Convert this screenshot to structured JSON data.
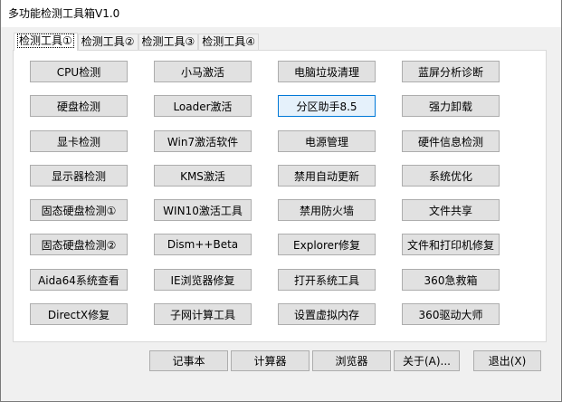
{
  "window": {
    "title": "多功能检测工具箱V1.0"
  },
  "tabs": [
    {
      "label": "检测工具①",
      "active": true
    },
    {
      "label": "检测工具②",
      "active": false
    },
    {
      "label": "检测工具③",
      "active": false
    },
    {
      "label": "检测工具④",
      "active": false
    }
  ],
  "grid": {
    "columns": [
      [
        "CPU检测",
        "硬盘检测",
        "显卡检测",
        "显示器检测",
        "固态硬盘检测①",
        "固态硬盘检测②",
        "Aida64系统查看",
        "DirectX修复"
      ],
      [
        "小马激活",
        "Loader激活",
        "Win7激活软件",
        "KMS激活",
        "WIN10激活工具",
        "Dism++Beta",
        "IE浏览器修复",
        "子网计算工具"
      ],
      [
        "电脑垃圾清理",
        "分区助手8.5",
        "电源管理",
        "禁用自动更新",
        "禁用防火墙",
        "Explorer修复",
        "打开系统工具",
        "设置虚拟内存"
      ],
      [
        "蓝屏分析诊断",
        "强力卸载",
        "硬件信息检测",
        "系统优化",
        "文件共享",
        "文件和打印机修复",
        "360急救箱",
        "360驱动大师"
      ]
    ]
  },
  "bottom": {
    "notepad": "记事本",
    "calculator": "计算器",
    "browser": "浏览器",
    "about": "关于(A)...",
    "exit": "退出(X)"
  }
}
